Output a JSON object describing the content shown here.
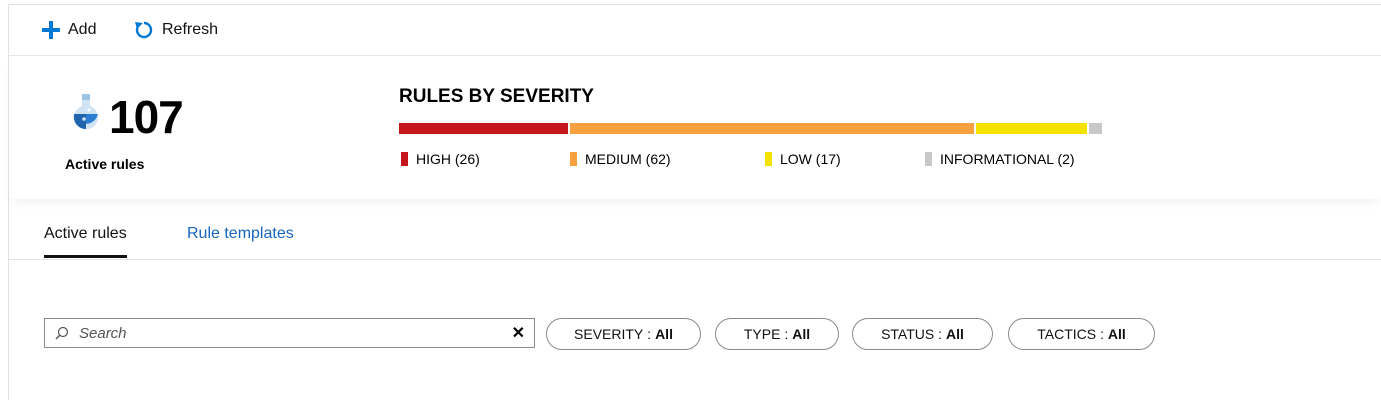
{
  "toolbar": {
    "add_label": "Add",
    "refresh_label": "Refresh",
    "accent": "#0078d4"
  },
  "summary": {
    "count": "107",
    "count_label": "Active rules",
    "severity_title": "RULES BY SEVERITY",
    "severities": [
      {
        "label": "HIGH (26)",
        "count": 26,
        "color": "#c4161c"
      },
      {
        "label": "MEDIUM (62)",
        "count": 62,
        "color": "#f7a13e"
      },
      {
        "label": "LOW (17)",
        "count": 17,
        "color": "#f5e200"
      },
      {
        "label": "INFORMATIONAL (2)",
        "count": 2,
        "color": "#c8c8c8"
      }
    ]
  },
  "tabs": [
    {
      "label": "Active rules",
      "active": true
    },
    {
      "label": "Rule templates",
      "active": false
    }
  ],
  "search": {
    "placeholder": "Search",
    "clear_icon": "close-icon"
  },
  "filters": [
    {
      "name": "SEVERITY",
      "value": "All"
    },
    {
      "name": "TYPE",
      "value": "All"
    },
    {
      "name": "STATUS",
      "value": "All"
    },
    {
      "name": "TACTICS",
      "value": "All"
    }
  ]
}
